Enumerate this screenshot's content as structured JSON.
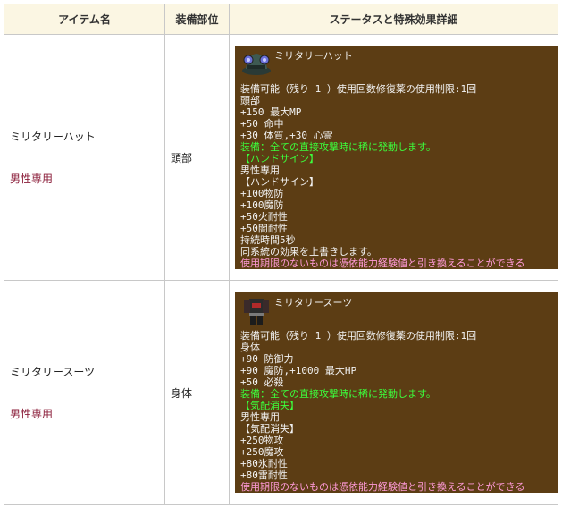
{
  "table": {
    "headers": [
      "アイテム名",
      "装備部位",
      "ステータスと特殊効果詳細"
    ]
  },
  "rows": [
    {
      "name": "ミリタリーハット",
      "gender": "男性専用",
      "slot": "頭部",
      "icon": "military-hat-icon",
      "tooltip_title": "ミリタリーハット",
      "lines": [
        {
          "text": "装備可能（残り 1 ）使用回数修復薬の使用制限:1回",
          "color": "white"
        },
        {
          "text": "頭部",
          "color": "white"
        },
        {
          "text": "+150 最大MP",
          "color": "white"
        },
        {
          "text": "+50 命中",
          "color": "white"
        },
        {
          "text": "+30 体質,+30 心霊",
          "color": "white"
        },
        {
          "text": "装備：全ての直接攻撃時に稀に発動します。",
          "color": "green"
        },
        {
          "text": "【ハンドサイン】",
          "color": "green"
        },
        {
          "text": "男性専用",
          "color": "white"
        },
        {
          "text": "【ハンドサイン】",
          "color": "white"
        },
        {
          "text": "+100物防",
          "color": "white"
        },
        {
          "text": "+100魔防",
          "color": "white"
        },
        {
          "text": "+50火耐性",
          "color": "white"
        },
        {
          "text": "+50闇耐性",
          "color": "white"
        },
        {
          "text": "持続時間5秒",
          "color": "white"
        },
        {
          "text": "同系統の効果を上書きします。",
          "color": "white"
        },
        {
          "text": "使用期限のないものは憑依能力経験値と引き換えることができる",
          "color": "pink"
        }
      ]
    },
    {
      "name": "ミリタリースーツ",
      "gender": "男性専用",
      "slot": "身体",
      "icon": "military-suit-icon",
      "tooltip_title": "ミリタリースーツ",
      "lines": [
        {
          "text": "装備可能（残り 1 ）使用回数修復薬の使用制限:1回",
          "color": "white"
        },
        {
          "text": "身体",
          "color": "white"
        },
        {
          "text": "+90 防御力",
          "color": "white"
        },
        {
          "text": "+90 魔防,+1000 最大HP",
          "color": "white"
        },
        {
          "text": "+50 必殺",
          "color": "white"
        },
        {
          "text": "装備：全ての直接攻撃時に稀に発動します。",
          "color": "green"
        },
        {
          "text": "【気配消失】",
          "color": "green"
        },
        {
          "text": "男性専用",
          "color": "white"
        },
        {
          "text": "【気配消失】",
          "color": "white"
        },
        {
          "text": "+250物攻",
          "color": "white"
        },
        {
          "text": "+250魔攻",
          "color": "white"
        },
        {
          "text": "+80氷耐性",
          "color": "white"
        },
        {
          "text": "+80雷耐性",
          "color": "white"
        },
        {
          "text": "使用期限のないものは憑依能力経験値と引き換えることができる",
          "color": "pink"
        }
      ]
    }
  ]
}
